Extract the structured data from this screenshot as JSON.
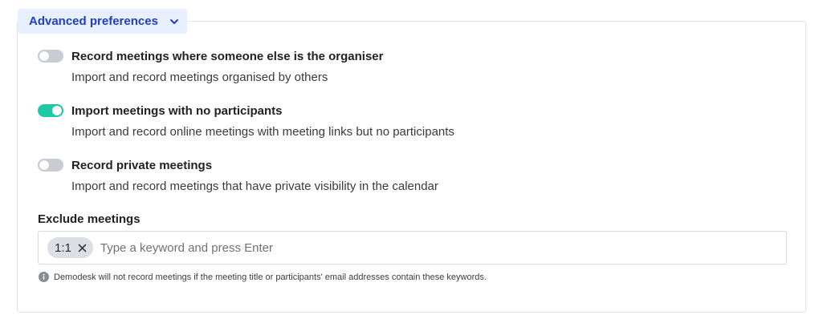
{
  "section": {
    "title": "Advanced preferences",
    "chevron_icon": "chevron-down-icon",
    "accent_color": "#1f3fc4"
  },
  "preferences": [
    {
      "title": "Record meetings where someone else is the organiser",
      "description": "Import and record meetings organised by others",
      "enabled": false
    },
    {
      "title": "Import meetings with no participants",
      "description": "Import and record online meetings with meeting links but no participants",
      "enabled": true
    },
    {
      "title": "Record private meetings",
      "description": "Import and record meetings that have private visibility in the calendar",
      "enabled": false
    }
  ],
  "exclude": {
    "label": "Exclude meetings",
    "tags": [
      "1:1"
    ],
    "placeholder": "Type a keyword and press Enter",
    "hint": "Demodesk will not record meetings if the meeting title or participants' email addresses contain these keywords.",
    "hint_icon": "info-icon"
  },
  "colors": {
    "toggle_on": "#1fc8a6",
    "toggle_off": "#c9ccd2"
  }
}
